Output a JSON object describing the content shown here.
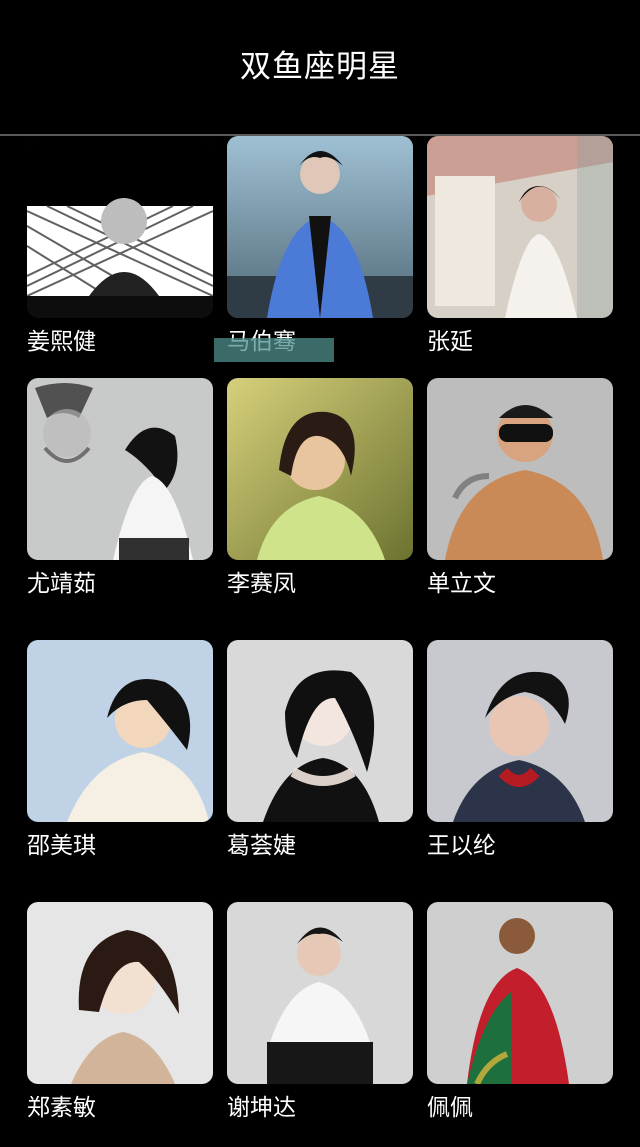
{
  "header": {
    "title": "双鱼座明星"
  },
  "celebrities": [
    {
      "name": "姜熙健",
      "tone": [
        "#7a7a7a",
        "#1f1f1f"
      ],
      "bg": "#ffffff"
    },
    {
      "name": "马伯骞",
      "tone": [
        "#4f7fd6",
        "#1a1f33"
      ],
      "bg": "#a8c5d7"
    },
    {
      "name": "张延",
      "tone": [
        "#e6e0d9",
        "#6b6b6b"
      ],
      "bg": "#d7d0c7"
    },
    {
      "name": "尤靖茹",
      "tone": [
        "#e9e9ea",
        "#2b2b2b"
      ],
      "bg": "#c8c9c9"
    },
    {
      "name": "李赛凤",
      "tone": [
        "#c9d38a",
        "#2f2a1d"
      ],
      "bg": "#b6b04f"
    },
    {
      "name": "单立文",
      "tone": [
        "#c98a57",
        "#1f1f1f"
      ],
      "bg": "#bdbdbd"
    },
    {
      "name": "邵美琪",
      "tone": [
        "#f2d7bd",
        "#1a1a1a"
      ],
      "bg": "#bfd2e6"
    },
    {
      "name": "葛荟婕",
      "tone": [
        "#f0f0f0",
        "#111111"
      ],
      "bg": "#d9d9d9"
    },
    {
      "name": "王以纶",
      "tone": [
        "#b8c2d8",
        "#141414"
      ],
      "bg": "#c8c9cf"
    },
    {
      "name": "郑素敏",
      "tone": [
        "#f2e0d0",
        "#2b1a14"
      ],
      "bg": "#e6e6e6"
    },
    {
      "name": "谢坤达",
      "tone": [
        "#ffffff",
        "#171717"
      ],
      "bg": "#d8d8d8"
    },
    {
      "name": "佩佩",
      "tone": [
        "#c21e2b",
        "#1a1a1a"
      ],
      "bg": "#cfcfcf"
    }
  ]
}
